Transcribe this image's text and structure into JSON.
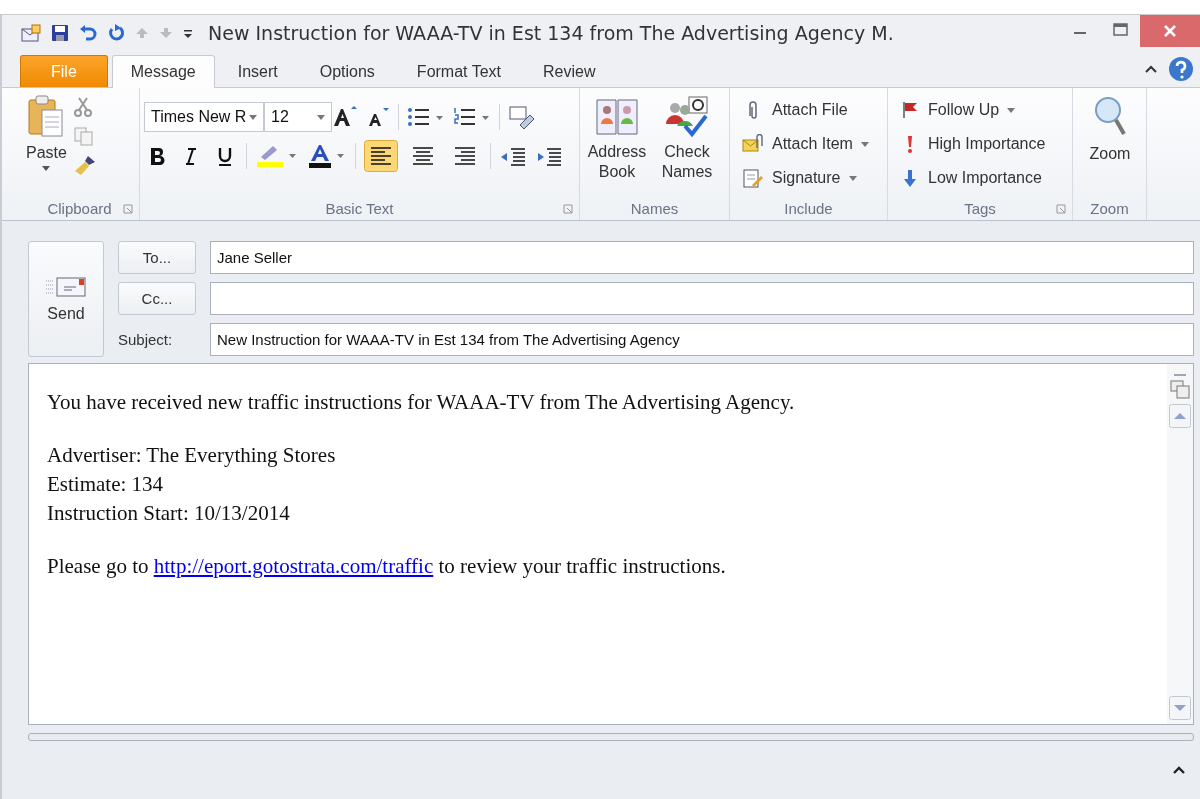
{
  "window": {
    "title": "New Instruction for WAAA-TV in Est 134 from The Advertising Agency M."
  },
  "tabs": [
    {
      "label": "File",
      "kind": "file",
      "selected": false
    },
    {
      "label": "Message",
      "kind": "tab",
      "selected": true
    },
    {
      "label": "Insert",
      "kind": "tab",
      "selected": false
    },
    {
      "label": "Options",
      "kind": "tab",
      "selected": false
    },
    {
      "label": "Format Text",
      "kind": "tab",
      "selected": false
    },
    {
      "label": "Review",
      "kind": "tab",
      "selected": false
    }
  ],
  "ribbon": {
    "clipboard": {
      "label": "Clipboard",
      "paste": "Paste"
    },
    "basic_text": {
      "label": "Basic Text",
      "font": "Times New R",
      "size": "12",
      "alignment": [
        {
          "kind": "left",
          "selected": true
        },
        {
          "kind": "center",
          "selected": false
        },
        {
          "kind": "right",
          "selected": false
        }
      ]
    },
    "names": {
      "label": "Names",
      "buttons": [
        {
          "kind": "book",
          "label": "Address Book"
        },
        {
          "kind": "check",
          "label": "Check Names"
        }
      ]
    },
    "include": {
      "label": "Include",
      "items": [
        {
          "kind": "file",
          "label": "Attach File",
          "dropdown": false
        },
        {
          "kind": "item",
          "label": "Attach Item",
          "dropdown": true
        },
        {
          "kind": "signature",
          "label": "Signature",
          "dropdown": true
        }
      ]
    },
    "tags": {
      "label": "Tags",
      "items": [
        {
          "kind": "flag",
          "label": "Follow Up",
          "dropdown": true
        },
        {
          "kind": "high",
          "label": "High Importance",
          "dropdown": false
        },
        {
          "kind": "low",
          "label": "Low Importance",
          "dropdown": false
        }
      ]
    },
    "zoom": {
      "label": "Zoom",
      "button": "Zoom"
    }
  },
  "header": {
    "send": "Send",
    "to_button": "To...",
    "to": "Jane Seller",
    "cc_button": "Cc...",
    "subject_label": "Subject:",
    "subject": "New Instruction for WAAA-TV in Est 134 from The Advertising Agency"
  },
  "body": [
    {
      "text": "You have received new traffic instructions for WAAA-TV from The Advertising Agency."
    },
    {
      "lines": [
        "Advertiser: The Everything Stores",
        "Estimate: 134",
        "Instruction Start: 10/13/2014"
      ]
    },
    {
      "before": "Please go to ",
      "link": "http://eport.gotostrata.com/traffic",
      "after": " to review your traffic instructions."
    }
  ]
}
